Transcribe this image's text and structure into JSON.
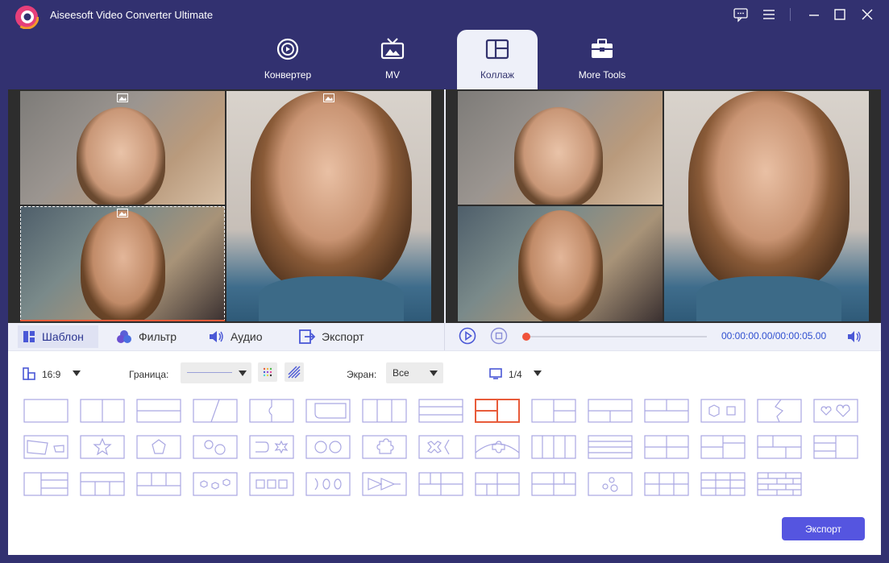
{
  "app": {
    "title": "Aiseesoft Video Converter Ultimate"
  },
  "nav": {
    "tabs": [
      {
        "label": "Конвертер",
        "icon": "convert-icon"
      },
      {
        "label": "MV",
        "icon": "tv-icon"
      },
      {
        "label": "Коллаж",
        "icon": "collage-icon",
        "active": true
      },
      {
        "label": "More Tools",
        "icon": "toolbox-icon"
      }
    ]
  },
  "editor_tabs": [
    {
      "label": "Шаблон",
      "icon": "template-icon",
      "active": true
    },
    {
      "label": "Фильтр",
      "icon": "filter-icon"
    },
    {
      "label": "Аудио",
      "icon": "audio-icon"
    },
    {
      "label": "Экспорт",
      "icon": "export-icon"
    }
  ],
  "player": {
    "time": "00:00:00.00/00:00:05.00",
    "progress": 0
  },
  "options": {
    "ratio": "16:9",
    "border_label": "Граница:",
    "screen_label": "Экран:",
    "screen_value": "Все",
    "page": "1/4"
  },
  "export_button": "Экспорт",
  "colors": {
    "accent": "#5555e0",
    "nav_bg": "#323170",
    "selected_template": "#e85b3a",
    "template_stroke": "#a9a7e2"
  }
}
